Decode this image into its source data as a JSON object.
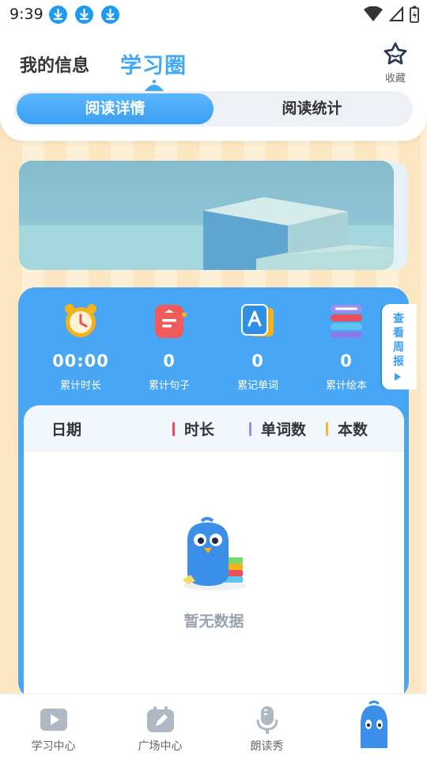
{
  "status_bar": {
    "time": "9:39",
    "icons": [
      "download-icon",
      "download-icon",
      "download-icon",
      "wifi-icon",
      "signal-icon",
      "battery-icon"
    ]
  },
  "header": {
    "tab_info": "我的信息",
    "tab_circle": "学习圈",
    "favorite_label": "收藏",
    "segments": [
      "阅读详情",
      "阅读统计"
    ],
    "active_segment": "阅读详情"
  },
  "stats": [
    {
      "icon": "alarm-clock-icon",
      "value": "00:00",
      "label": "累计时长"
    },
    {
      "icon": "sentence-card-icon",
      "value": "0",
      "label": "累计句子"
    },
    {
      "icon": "word-card-icon",
      "value": "0",
      "label": "累记单词"
    },
    {
      "icon": "book-stack-icon",
      "value": "0",
      "label": "累计绘本"
    }
  ],
  "weekly_report": "查看周报",
  "table": {
    "columns": [
      "日期",
      "时长",
      "单词数",
      "本数"
    ],
    "empty_text": "暂无数据"
  },
  "bottom_nav": [
    {
      "icon": "video-play-icon",
      "label": "学习中心"
    },
    {
      "icon": "pencil-icon",
      "label": "广场中心"
    },
    {
      "icon": "microphone-icon",
      "label": "朗读秀"
    },
    {
      "icon": "bird-mascot-icon",
      "label": ""
    }
  ],
  "colors": {
    "primary": "#48a6f5",
    "accent_red": "#e9505a",
    "accent_purple": "#9b8ff0",
    "accent_yellow": "#f2b63c",
    "background": "#fde7c2"
  }
}
